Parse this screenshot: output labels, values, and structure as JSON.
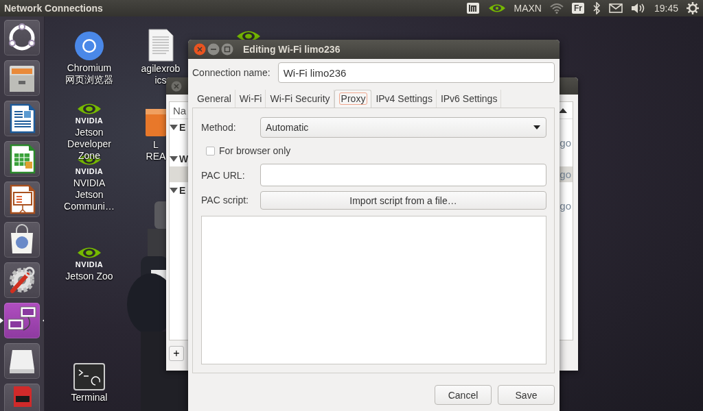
{
  "top_bar": {
    "title": "Network Connections",
    "indicators": [
      {
        "kind": "app"
      },
      {
        "kind": "nvidia"
      },
      {
        "kind": "text",
        "text": "MAXN"
      },
      {
        "kind": "wifi"
      },
      {
        "kind": "keyboard",
        "text": "Fr"
      },
      {
        "kind": "bluetooth"
      },
      {
        "kind": "mail"
      },
      {
        "kind": "volume"
      },
      {
        "kind": "text",
        "text": "19:45"
      },
      {
        "kind": "gear"
      }
    ]
  },
  "launcher": [
    {
      "kind": "ubuntu",
      "active": false
    },
    {
      "kind": "files",
      "active": false
    },
    {
      "kind": "writer",
      "active": false
    },
    {
      "kind": "calc",
      "active": false
    },
    {
      "kind": "impress",
      "active": false
    },
    {
      "kind": "software",
      "active": false
    },
    {
      "kind": "settings",
      "active": false
    },
    {
      "kind": "network",
      "active": true
    },
    {
      "kind": "drive",
      "active": false
    },
    {
      "kind": "sdcard",
      "active": false
    }
  ],
  "desktop_icons": [
    {
      "kind": "chromium",
      "lines": [
        "Chromium",
        "网页浏览器"
      ]
    },
    {
      "kind": "document",
      "lines": [
        "agilexrob",
        "ics"
      ]
    },
    {
      "kind": "nvidia"
    },
    {
      "kind": "nvidia",
      "logo": "NVIDIA",
      "lines": [
        "Jetson",
        "Developer",
        "Zone"
      ]
    },
    {
      "kind": "folder",
      "lines": [
        "L",
        "REA"
      ]
    },
    {
      "kind": "nvidia",
      "logo": "NVIDIA",
      "lines": [
        "NVIDIA",
        "Jetson",
        "Communi…"
      ]
    },
    {
      "kind": "nvidia",
      "logo": "NVIDIA",
      "lines": [
        "Jetson Zoo"
      ]
    },
    {
      "kind": "terminal",
      "lines": [
        "Terminal"
      ]
    }
  ],
  "background_window": {
    "header": "Na",
    "rows": [
      {
        "kind": "group",
        "label": "E",
        "expanded": true
      },
      {
        "kind": "connection",
        "detail": "go",
        "selected": false
      },
      {
        "kind": "group",
        "label": "W",
        "expanded": true
      },
      {
        "kind": "connection",
        "detail": "go",
        "selected": true
      },
      {
        "kind": "group",
        "label": "E",
        "expanded": true
      },
      {
        "kind": "connection",
        "detail": "go",
        "selected": false
      }
    ],
    "add_button": "+"
  },
  "dialog": {
    "title": "Editing Wi-Fi limo236",
    "connection_name": {
      "label": "Connection name:",
      "value": "Wi-Fi limo236"
    },
    "tabs": [
      {
        "label": "General",
        "selected": false
      },
      {
        "label": "Wi-Fi",
        "selected": false
      },
      {
        "label": "Wi-Fi Security",
        "selected": false
      },
      {
        "label": "Proxy",
        "selected": true
      },
      {
        "label": "IPv4 Settings",
        "selected": false
      },
      {
        "label": "IPv6 Settings",
        "selected": false
      }
    ],
    "method": {
      "label": "Method:",
      "value": "Automatic"
    },
    "browser_only": {
      "label": "For browser only",
      "checked": false
    },
    "pac_url": {
      "label": "PAC URL:"
    },
    "pac_script": {
      "label": "PAC script:",
      "button": "Import script from a file…"
    },
    "buttons": [
      "Cancel",
      "Save"
    ]
  }
}
